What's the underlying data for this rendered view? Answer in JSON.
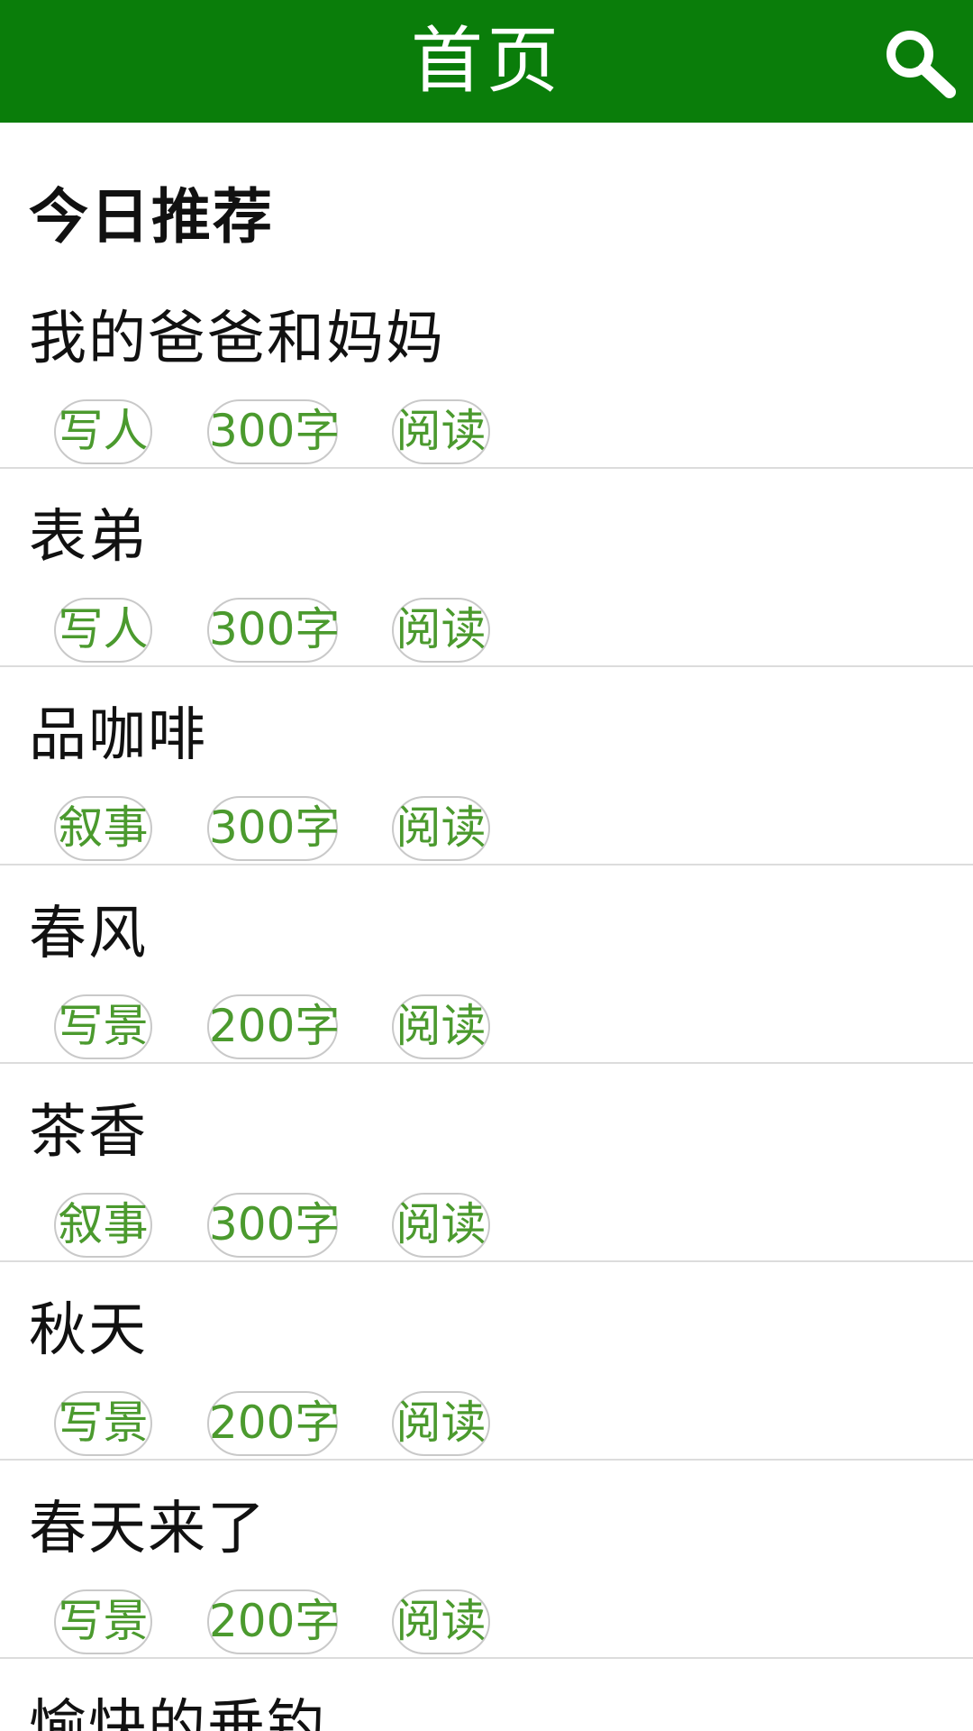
{
  "header": {
    "title": "首页",
    "bar_color": "#0a7d0a"
  },
  "section": {
    "title": "今日推荐"
  },
  "tag_color": "#4b9a2e",
  "articles": [
    {
      "title": "我的爸爸和妈妈",
      "category": "写人",
      "length": "300字",
      "read_label": "阅读"
    },
    {
      "title": "表弟",
      "category": "写人",
      "length": "300字",
      "read_label": "阅读"
    },
    {
      "title": "品咖啡",
      "category": "叙事",
      "length": "300字",
      "read_label": "阅读"
    },
    {
      "title": "春风",
      "category": "写景",
      "length": "200字",
      "read_label": "阅读"
    },
    {
      "title": "茶香",
      "category": "叙事",
      "length": "300字",
      "read_label": "阅读"
    },
    {
      "title": "秋天",
      "category": "写景",
      "length": "200字",
      "read_label": "阅读"
    },
    {
      "title": "春天来了",
      "category": "写景",
      "length": "200字",
      "read_label": "阅读"
    },
    {
      "title": "愉快的垂钓"
    }
  ]
}
